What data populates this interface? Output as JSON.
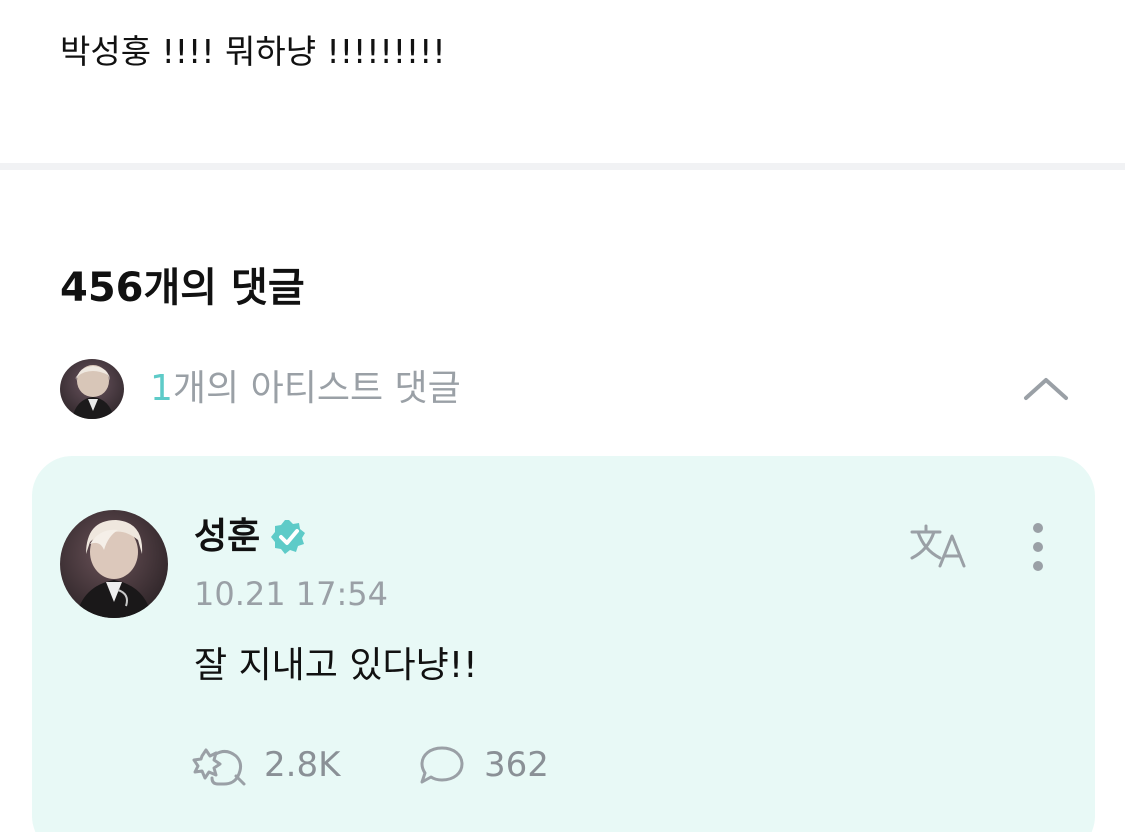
{
  "post": {
    "text": "박성훙 !!!! 뭐하냥 !!!!!!!!!"
  },
  "comments": {
    "title": "456개의 댓글",
    "artist_section": {
      "count": "1",
      "label": "개의 아티스트 댓글",
      "collapse_icon": "chevron-up-icon"
    }
  },
  "comment": {
    "author": "성훈",
    "verified_icon": "verified-badge-icon",
    "timestamp": "10.21 17:54",
    "body": "잘 지내고 있다냥!!",
    "translate_icon": "translate-icon",
    "more_icon": "more-vertical-icon",
    "likes": "2.8K",
    "replies": "362",
    "like_icon": "cheer-icon",
    "reply_icon": "speech-bubble-icon"
  },
  "colors": {
    "accent": "#5ecbc8",
    "card_bg": "#e8f9f6",
    "muted_text": "#9aa0a6"
  }
}
